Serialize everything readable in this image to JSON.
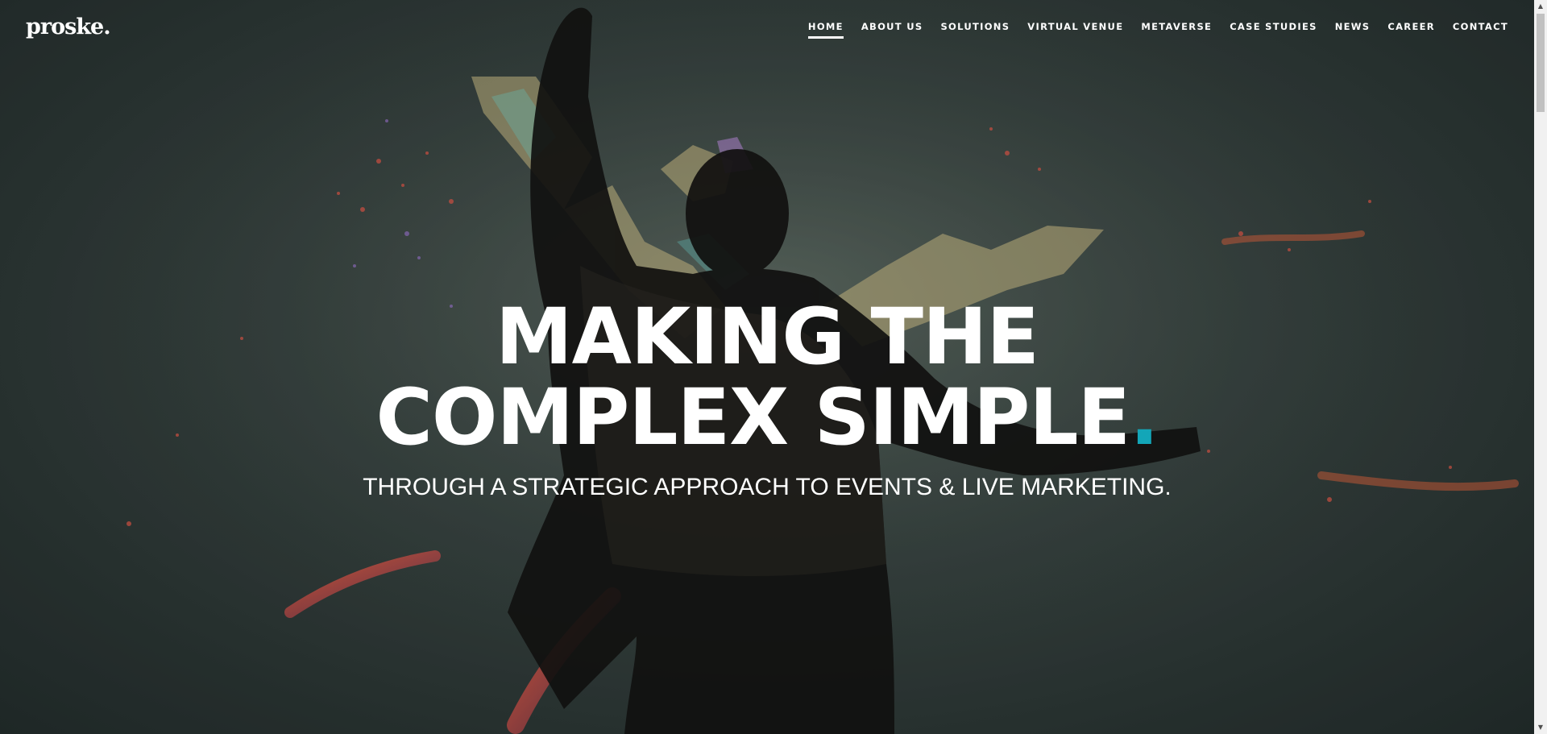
{
  "brand": {
    "logo_text": "proske."
  },
  "nav": {
    "items": [
      {
        "label": "HOME",
        "active": true
      },
      {
        "label": "ABOUT US",
        "active": false
      },
      {
        "label": "SOLUTIONS",
        "active": false
      },
      {
        "label": "VIRTUAL VENUE",
        "active": false
      },
      {
        "label": "METAVERSE",
        "active": false
      },
      {
        "label": "CASE STUDIES",
        "active": false
      },
      {
        "label": "NEWS",
        "active": false
      },
      {
        "label": "CAREER",
        "active": false
      },
      {
        "label": "CONTACT",
        "active": false
      }
    ]
  },
  "hero": {
    "headline_line1": "MAKING THE",
    "headline_line2": "COMPLEX SIMPLE",
    "headline_dot": ".",
    "subline": "THROUGH A STRATEGIC APPROACH TO EVENTS & LIVE MARKETING.",
    "accent_color": "#13a6b8"
  },
  "scrollbar": {
    "up_icon": "triangle-up-icon",
    "down_icon": "triangle-down-icon"
  }
}
